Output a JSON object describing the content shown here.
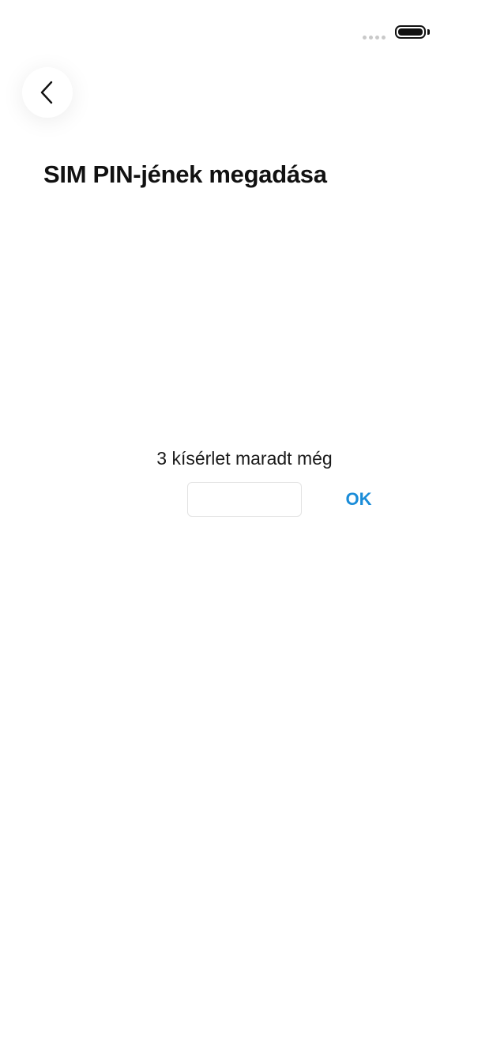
{
  "status_bar": {
    "signal_icon": "signal-dots-icon",
    "battery_icon": "battery-icon",
    "battery_level": 1.0
  },
  "header": {
    "back_icon": "chevron-left-icon",
    "title": "SIM PIN-jének megadása"
  },
  "pin_entry": {
    "attempts_text": "3 kísérlet maradt még",
    "input_value": "",
    "ok_label": "OK"
  },
  "colors": {
    "accent": "#1a8cd8",
    "background": "#ffffff",
    "text": "#111111"
  }
}
